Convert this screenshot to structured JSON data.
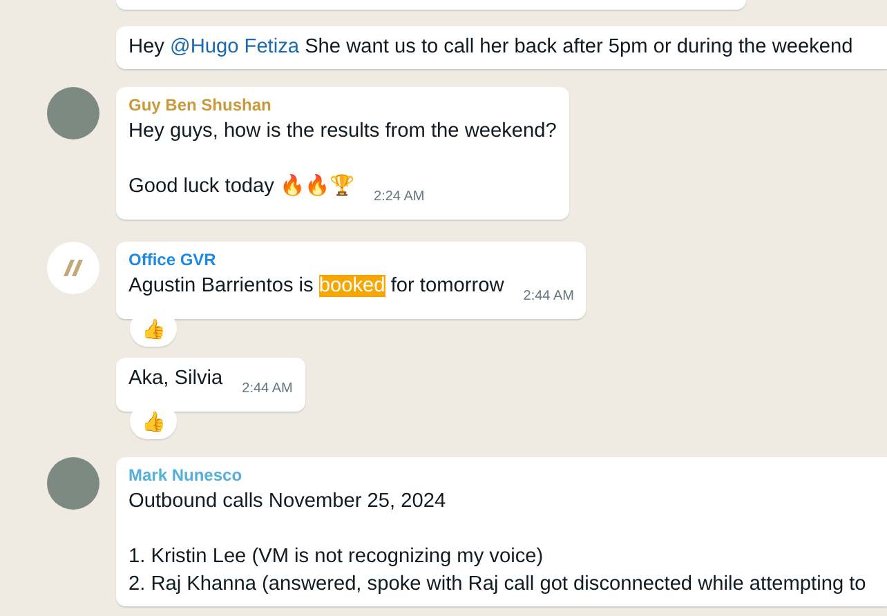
{
  "messages": [
    {
      "kind": "cut"
    },
    {
      "kind": "continuation",
      "paragraphs": [
        [
          [
            {
              "text": "Hey "
            },
            {
              "text": "@Hugo Fetiza",
              "kind": "mention"
            },
            {
              "text": " She want us to call her back after 5pm or during the weekend"
            }
          ]
        ]
      ]
    },
    {
      "kind": "sender_photo",
      "sender": "Guy Ben Shushan",
      "color": "#c89a3c",
      "time": "2:24 AM",
      "paragraphs": [
        [
          [
            {
              "text": "Hey guys, how is the results from the weekend?"
            }
          ]
        ],
        [
          [
            {
              "text": "Good luck today 🔥🔥🏆"
            }
          ]
        ]
      ]
    },
    {
      "kind": "sender_logo",
      "sender": "Office GVR",
      "color": "#1f8ae0",
      "time": "2:44 AM",
      "reaction": "👍",
      "paragraphs": [
        [
          [
            {
              "text": "Agustin Barrientos is "
            },
            {
              "text": "booked",
              "kind": "highlight"
            },
            {
              "text": " for tomorrow"
            }
          ]
        ]
      ]
    },
    {
      "kind": "continuation",
      "time": "2:44 AM",
      "reaction": "👍",
      "paragraphs": [
        [
          [
            {
              "text": "Aka, Silvia"
            }
          ]
        ]
      ]
    },
    {
      "kind": "sender_photo",
      "sender": "Mark Nunesco",
      "color": "#53b0dc",
      "paragraphs": [
        [
          [
            {
              "text": "Outbound calls November 25, 2024"
            }
          ]
        ],
        [
          [
            {
              "text": "1. Kristin Lee (VM is not recognizing my voice)"
            }
          ],
          [
            {
              "text": "2. Raj Khanna (answered, spoke with Raj call got disconnected while attempting to"
            }
          ]
        ]
      ]
    }
  ]
}
